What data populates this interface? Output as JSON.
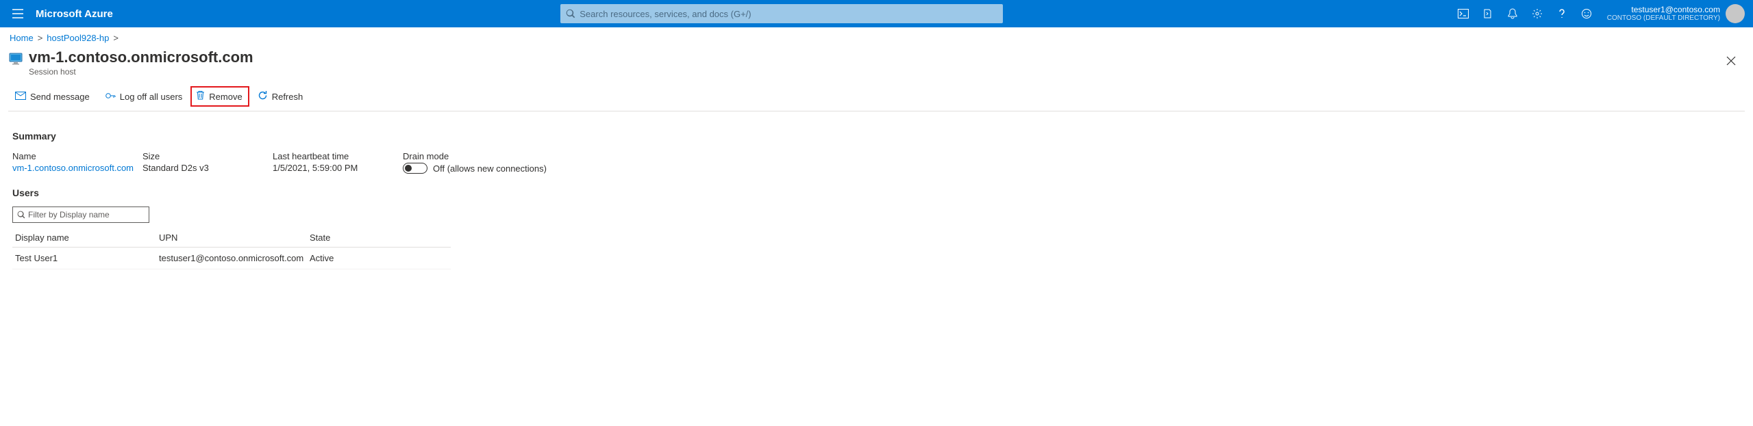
{
  "header": {
    "brand": "Microsoft Azure",
    "search_placeholder": "Search resources, services, and docs (G+/)",
    "user_email": "testuser1@contoso.com",
    "user_directory": "CONTOSO (DEFAULT DIRECTORY)"
  },
  "breadcrumb": {
    "home": "Home",
    "parent": "hostPool928-hp"
  },
  "page": {
    "title": "vm-1.contoso.onmicrosoft.com",
    "subtitle": "Session host"
  },
  "commands": {
    "send_message": "Send message",
    "log_off": "Log off all users",
    "remove": "Remove",
    "refresh": "Refresh"
  },
  "summary": {
    "heading": "Summary",
    "name_label": "Name",
    "name_value": "vm-1.contoso.onmicrosoft.com",
    "size_label": "Size",
    "size_value": "Standard D2s v3",
    "heartbeat_label": "Last heartbeat time",
    "heartbeat_value": "1/5/2021, 5:59:00 PM",
    "drain_label": "Drain mode",
    "drain_value": "Off (allows new connections)"
  },
  "users": {
    "heading": "Users",
    "filter_placeholder": "Filter by Display name",
    "columns": {
      "display_name": "Display name",
      "upn": "UPN",
      "state": "State"
    },
    "rows": [
      {
        "display_name": "Test User1",
        "upn": "testuser1@contoso.onmicrosoft.com",
        "state": "Active"
      }
    ]
  }
}
